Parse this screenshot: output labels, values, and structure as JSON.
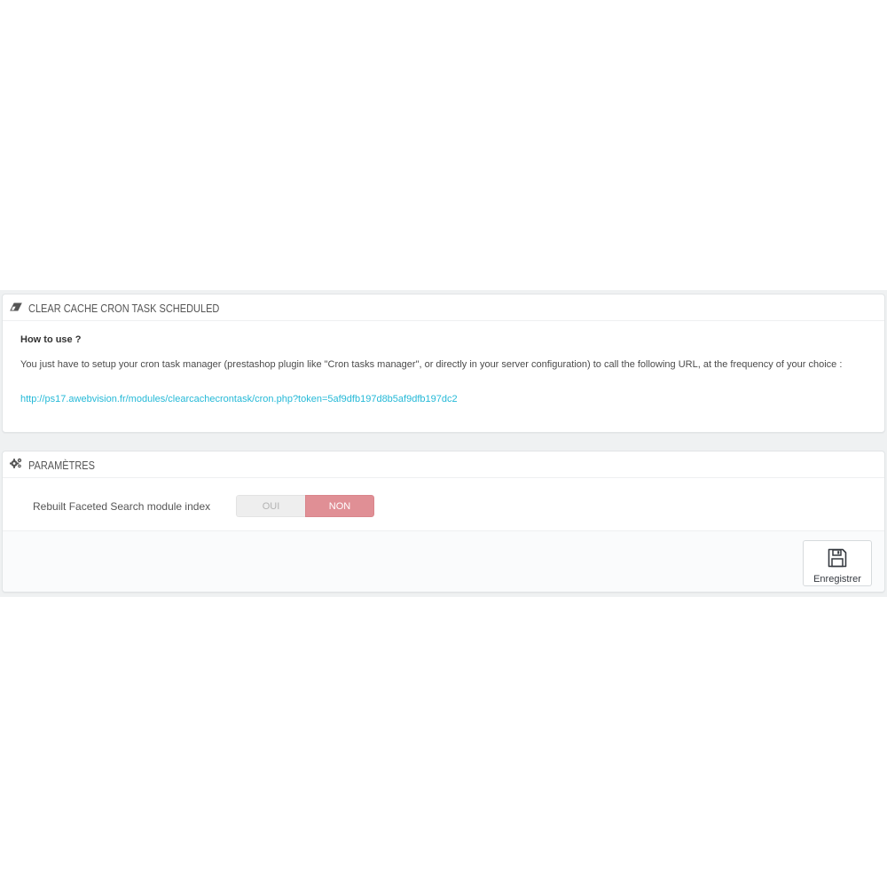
{
  "cron_panel": {
    "heading": "CLEAR CACHE CRON TASK SCHEDULED",
    "heading_icon": "eraser-icon",
    "howto_title": "How to use ?",
    "description": "You just have to setup your cron task manager (prestashop plugin like \"Cron tasks manager\", or directly in your server configuration) to call the following URL, at the frequency of your choice :",
    "cron_url": "http://ps17.awebvision.fr/modules/clearcachecrontask/cron.php?token=5af9dfb197d8b5af9dfb197dc2"
  },
  "settings_panel": {
    "heading": "PARAMÈTRES",
    "heading_icon": "cogs-icon",
    "field_label": "Rebuilt Faceted Search module index",
    "switch": {
      "yes_label": "OUI",
      "no_label": "NON",
      "selected": "NON"
    },
    "save_label": "Enregistrer",
    "save_icon": "floppy-disk-icon"
  },
  "colors": {
    "link": "#25b9d7",
    "switch_active_no": "#e08f95",
    "band_background": "#eff1f2"
  }
}
